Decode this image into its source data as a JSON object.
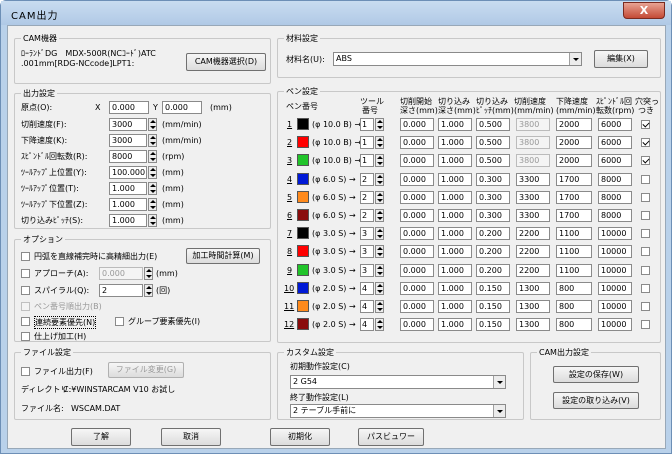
{
  "window": {
    "title": "CAM出力",
    "close": "X"
  },
  "cam": {
    "group": "CAM機器",
    "device_line1": "ﾛｰﾗﾝﾄﾞDG　MDX-500R(NCｺｰﾄﾞ)ATC",
    "device_line2": ".001mm[RDG-NCcode]LPT1:",
    "select_button": "CAM機器選択(D)"
  },
  "output": {
    "group": "出力設定",
    "origin_label": "原点(O):",
    "x_label": "X",
    "x_value": "0.000",
    "y_label": "Y",
    "y_value": "0.000",
    "origin_unit": "(mm)",
    "rows": [
      {
        "label": "切削速度(F):",
        "value": "3000",
        "unit": "(mm/min)"
      },
      {
        "label": "下降速度(K):",
        "value": "3000",
        "unit": "(mm/min)"
      },
      {
        "label": "ｽﾋﾟﾝﾄﾞﾙ回転数(R):",
        "value": "8000",
        "unit": "(rpm)"
      },
      {
        "label": "ﾂｰﾙｱｯﾌﾟ上位置(Y):",
        "value": "100.000",
        "unit": "(mm)"
      },
      {
        "label": "ﾂｰﾙｱｯﾌﾟ位置(T):",
        "value": "1.000",
        "unit": "(mm)"
      },
      {
        "label": "ﾂｰﾙｱｯﾌﾟ下位置(Z):",
        "value": "1.000",
        "unit": "(mm)"
      },
      {
        "label": "切り込みﾋﾟｯﾁ(S):",
        "value": "1.000",
        "unit": "(mm)"
      }
    ]
  },
  "options": {
    "group": "オプション",
    "arc_label": "円弧を直線補完時に高精細出力(E)",
    "calc_button": "加工時間計算(M)",
    "approach_label": "アプローチ(A):",
    "approach_value": "0.000",
    "approach_unit": "(mm)",
    "spiral_label": "スパイラル(Q):",
    "spiral_value": "2",
    "spiral_unit": "(回)",
    "pen_order_label": "ペン番号順出力(B)",
    "continuous_label": "連続要素優先(N)",
    "group_label": "グループ要素優先(I)",
    "finish_label": "仕上げ加工(H)"
  },
  "file": {
    "group": "ファイル設定",
    "output_label": "ファイル出力(F)",
    "change_button": "ファイル変更(G)",
    "dir_label": "ディレクトリ:",
    "dir_value": "C:¥WINSTARCAM V10 お試し",
    "name_label": "ファイル名:",
    "name_value": "WSCAM.DAT"
  },
  "material": {
    "group": "材料設定",
    "label": "材料名(U):",
    "value": "ABS",
    "edit_button": "編集(X)"
  },
  "pen": {
    "group": "ペン設定",
    "headers": {
      "pen_no": "ペン番号",
      "tool1": "ツール",
      "tool2": "番号",
      "start1": "切削開始",
      "start2": "深さ(mm)",
      "depth1": "切り込み",
      "depth2": "深さ(mm)",
      "pitch1": "切り込み",
      "pitch2": "ﾋﾟｯﾁ(mm)",
      "speed1": "切削速度",
      "speed2": "(mm/min)",
      "down1": "下降速度",
      "down2": "(mm/min)",
      "spindle1": "ｽﾋﾟﾝﾄﾞﾙ回",
      "spindle2": "転数(rpm)",
      "hole1": "穴突っ",
      "hole2": "つき"
    },
    "rows": [
      {
        "no": "1",
        "color": "#000000",
        "tool_name": "(φ 10.0 B) →",
        "tool": "1",
        "start": "0.000",
        "depth": "1.000",
        "pitch": "0.500",
        "speed": "3800",
        "speed_disabled": true,
        "down": "2000",
        "spindle": "6000",
        "hole": true
      },
      {
        "no": "2",
        "color": "#ff0000",
        "tool_name": "(φ 10.0 B) →",
        "tool": "1",
        "start": "0.000",
        "depth": "1.000",
        "pitch": "0.500",
        "speed": "3800",
        "speed_disabled": true,
        "down": "2000",
        "spindle": "6000",
        "hole": true
      },
      {
        "no": "3",
        "color": "#21c42a",
        "tool_name": "(φ 10.0 B) →",
        "tool": "1",
        "start": "0.000",
        "depth": "1.000",
        "pitch": "0.500",
        "speed": "3800",
        "speed_disabled": true,
        "down": "2000",
        "spindle": "6000",
        "hole": true
      },
      {
        "no": "4",
        "color": "#0019d6",
        "tool_name": "(φ 6.0 S) →",
        "tool": "2",
        "start": "0.000",
        "depth": "1.000",
        "pitch": "0.300",
        "speed": "3300",
        "speed_disabled": false,
        "down": "1700",
        "spindle": "8000",
        "hole": false
      },
      {
        "no": "5",
        "color": "#ff8a1c",
        "tool_name": "(φ 6.0 S) →",
        "tool": "2",
        "start": "0.000",
        "depth": "1.000",
        "pitch": "0.300",
        "speed": "3300",
        "speed_disabled": false,
        "down": "1700",
        "spindle": "8000",
        "hole": false
      },
      {
        "no": "6",
        "color": "#8a0c0c",
        "tool_name": "(φ 6.0 S) →",
        "tool": "2",
        "start": "0.000",
        "depth": "1.000",
        "pitch": "0.300",
        "speed": "3300",
        "speed_disabled": false,
        "down": "1700",
        "spindle": "8000",
        "hole": false
      },
      {
        "no": "7",
        "color": "#000000",
        "tool_name": "(φ 3.0 S) →",
        "tool": "3",
        "start": "0.000",
        "depth": "1.000",
        "pitch": "0.200",
        "speed": "2200",
        "speed_disabled": false,
        "down": "1100",
        "spindle": "10000",
        "hole": false
      },
      {
        "no": "8",
        "color": "#ff0000",
        "tool_name": "(φ 3.0 S) →",
        "tool": "3",
        "start": "0.000",
        "depth": "1.000",
        "pitch": "0.200",
        "speed": "2200",
        "speed_disabled": false,
        "down": "1100",
        "spindle": "10000",
        "hole": false
      },
      {
        "no": "9",
        "color": "#21c42a",
        "tool_name": "(φ 3.0 S) →",
        "tool": "3",
        "start": "0.000",
        "depth": "1.000",
        "pitch": "0.200",
        "speed": "2200",
        "speed_disabled": false,
        "down": "1100",
        "spindle": "10000",
        "hole": false
      },
      {
        "no": "10",
        "color": "#0019d6",
        "tool_name": "(φ 2.0 S) →",
        "tool": "4",
        "start": "0.000",
        "depth": "1.000",
        "pitch": "0.150",
        "speed": "1300",
        "speed_disabled": false,
        "down": "800",
        "spindle": "10000",
        "hole": false
      },
      {
        "no": "11",
        "color": "#ff8a1c",
        "tool_name": "(φ 2.0 S) →",
        "tool": "4",
        "start": "0.000",
        "depth": "1.000",
        "pitch": "0.150",
        "speed": "1300",
        "speed_disabled": false,
        "down": "800",
        "spindle": "10000",
        "hole": false
      },
      {
        "no": "12",
        "color": "#8a0c0c",
        "tool_name": "(φ 2.0 S) →",
        "tool": "4",
        "start": "0.000",
        "depth": "1.000",
        "pitch": "0.150",
        "speed": "1300",
        "speed_disabled": false,
        "down": "800",
        "spindle": "10000",
        "hole": false
      }
    ]
  },
  "custom": {
    "group": "カスタム設定",
    "initial_label": "初期動作設定(C)",
    "initial_value": "2 G54",
    "end_label": "終了動作設定(L)",
    "end_value": "2 テーブル手前に"
  },
  "camset": {
    "group": "CAM出力設定",
    "save_button": "設定の保存(W)",
    "load_button": "設定の取り込み(V)"
  },
  "footer": {
    "ok": "了解",
    "cancel": "取消",
    "init": "初期化",
    "preview": "パスビュワー"
  }
}
